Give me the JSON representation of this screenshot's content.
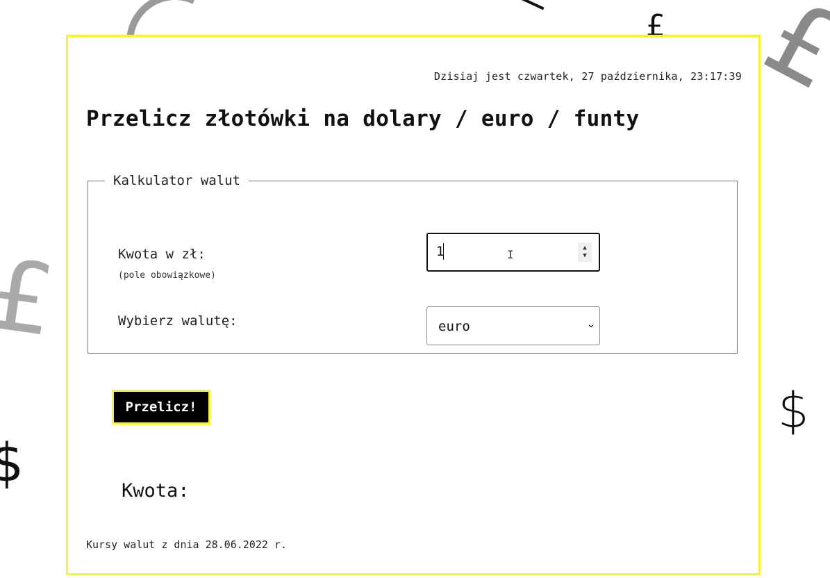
{
  "header": {
    "datetime": "Dzisiaj jest czwartek, 27 października, 23:17:39"
  },
  "title": "Przelicz złotówki na dolary / euro / funty",
  "calculator": {
    "legend": "Kalkulator walut",
    "amount_label": "Kwota w zł:",
    "amount_required_note": "(pole obowiązkowe)",
    "amount_value": "1",
    "currency_label": "Wybierz walutę:",
    "currency_selected": "euro"
  },
  "convert_button_label": "Przelicz!",
  "result_label": "Kwota:",
  "footer": {
    "rates_date": "Kursy walut z dnia 28.06.2022 r."
  },
  "background_symbols": {
    "pound": "£",
    "dollar": "$"
  },
  "colors": {
    "accent_yellow": "#f5f52a",
    "button_bg": "#000000",
    "button_text": "#ffffff"
  },
  "icons": {
    "spinner_up": "▲",
    "spinner_down": "▼",
    "select_chevron": "⌄"
  }
}
